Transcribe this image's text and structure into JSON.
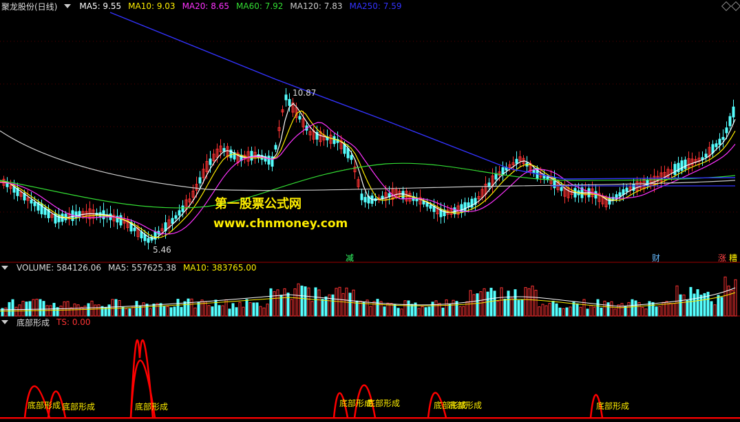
{
  "header": {
    "stock_name": "聚龙股份(日线)",
    "ma_indicators": [
      {
        "label": "MA5: 9.55",
        "color": "#ffffff"
      },
      {
        "label": "MA10: 9.03",
        "color": "#ffee00"
      },
      {
        "label": "MA20: 8.65",
        "color": "#ff33ff"
      },
      {
        "label": "MA60: 7.92",
        "color": "#33dd33"
      },
      {
        "label": "MA120: 7.83",
        "color": "#cccccc"
      },
      {
        "label": "MA250: 7.59",
        "color": "#3333ff"
      }
    ]
  },
  "price_chart": {
    "high_label": "10.87",
    "low_label": "5.46",
    "markers": [
      {
        "text": "减",
        "color": "#33ff66"
      },
      {
        "text": "财",
        "color": "#66bbff"
      },
      {
        "text": "涨",
        "color": "#ff4444"
      },
      {
        "text": "糟",
        "color": "#ffee00"
      }
    ]
  },
  "volume_panel": {
    "labels": [
      {
        "text": "VOLUME: 584126.06",
        "color": "#dddddd"
      },
      {
        "text": "MA5: 557625.38",
        "color": "#dddddd"
      },
      {
        "text": "MA10: 383765.00",
        "color": "#ffee00"
      }
    ]
  },
  "indicator_panel": {
    "name": "底部形成",
    "ts_label": "TS: 0.00",
    "signals": [
      "底部形成",
      "底部形成",
      "底部形成",
      "底部形成",
      "底部形成",
      "底部形成",
      "底部形成",
      "底部形成"
    ]
  },
  "watermark": {
    "line1": "第一股票公式网",
    "line2": "www.chnmoney.com"
  },
  "colors": {
    "up": "#ff3333",
    "down": "#55ffff",
    "ma250": "#3333ff",
    "ma60": "#33dd33",
    "ma20": "#ff33ff",
    "ma10": "#ffee00",
    "ma5": "#ffffff",
    "ma120": "#cccccc",
    "ts": "#ff0000"
  }
}
